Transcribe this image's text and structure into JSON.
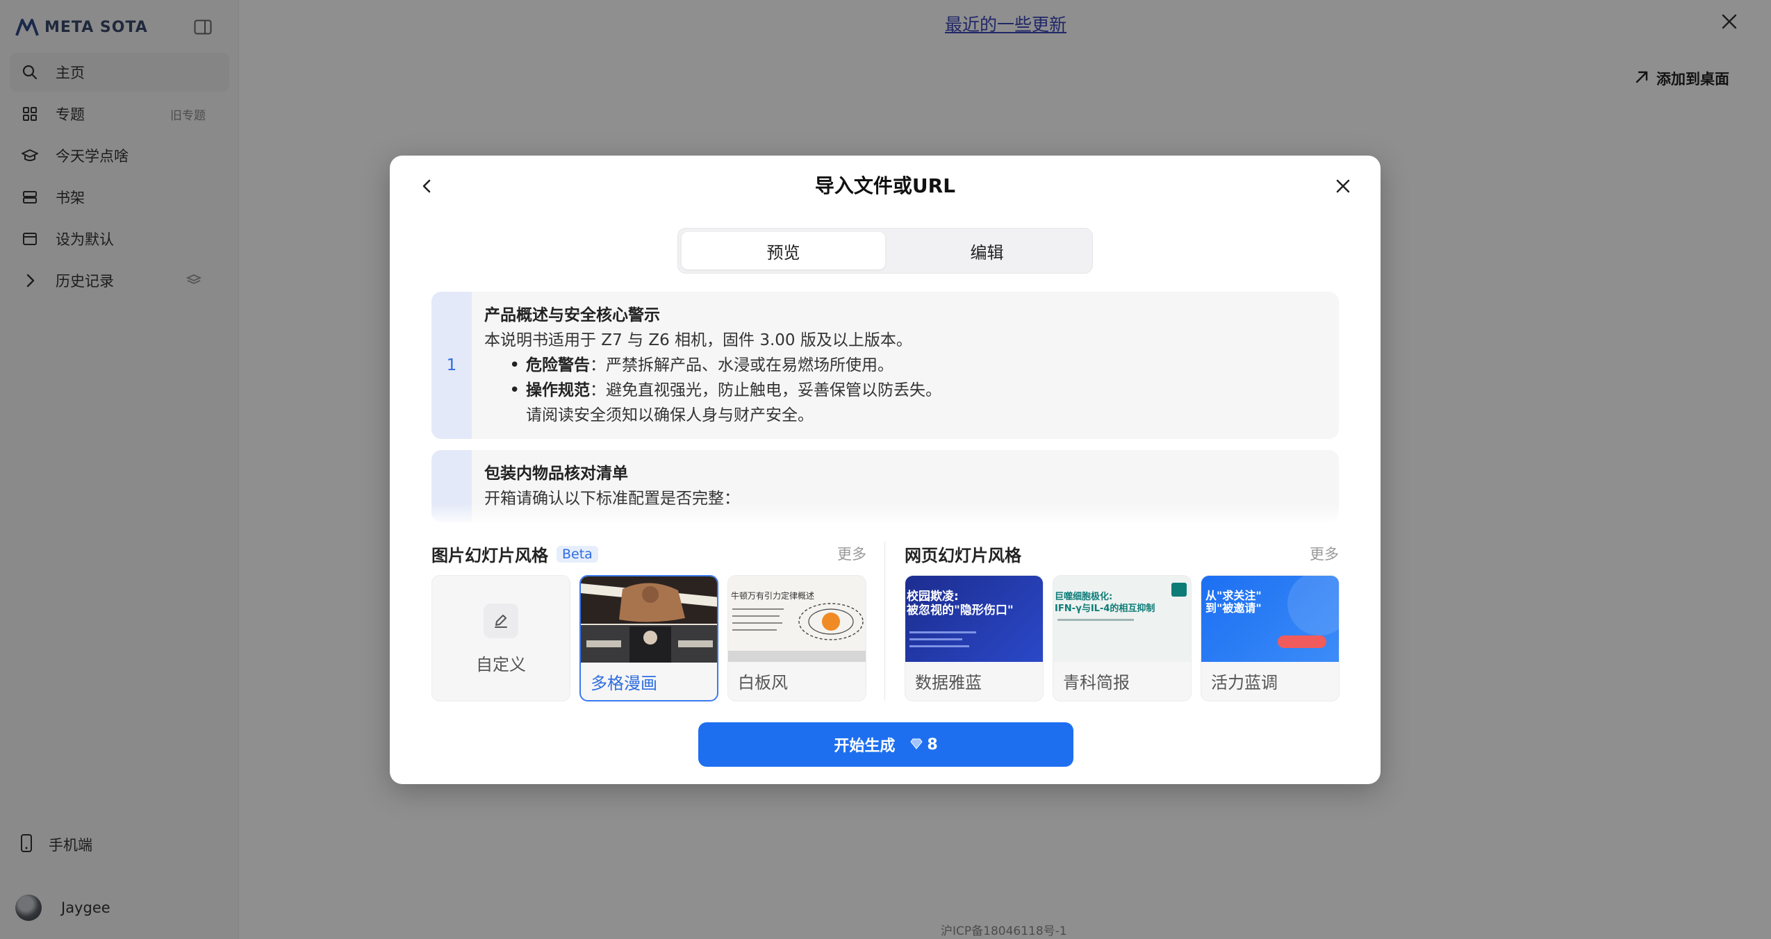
{
  "brand": {
    "name": "META SOTA"
  },
  "sidebar": {
    "items": [
      {
        "label": "主页",
        "icon": "search-icon"
      },
      {
        "label": "专题",
        "icon": "grid-icon",
        "badge": "旧专题"
      },
      {
        "label": "今天学点啥",
        "icon": "graduation-cap-icon"
      },
      {
        "label": "书架",
        "icon": "shelf-icon"
      },
      {
        "label": "设为默认",
        "icon": "window-icon"
      },
      {
        "label": "历史记录",
        "icon": "chevron-right-icon"
      }
    ],
    "mobile": "手机端",
    "user": "Jaygee"
  },
  "page": {
    "banner": "最近的一些更新",
    "add_desktop": "添加到桌面",
    "icp": "沪ICP备18046118号-1"
  },
  "modal": {
    "title": "导入文件或URL",
    "tabs": [
      {
        "label": "预览",
        "active": true
      },
      {
        "label": "编辑",
        "active": false
      }
    ],
    "cards": [
      {
        "num": "1",
        "title": "产品概述与安全核心警示",
        "intro": "本说明书适用于 Z7 与 Z6 相机，固件 3.00 版及以上版本。",
        "bullets": [
          {
            "bold": "危险警告",
            "text": "：严禁拆解产品、水浸或在易燃场所使用。"
          },
          {
            "bold": "操作规范",
            "text": "：避免直视强光，防止触电，妥善保管以防丢失。"
          }
        ],
        "note": "请阅读安全须知以确保人身与财产安全。"
      },
      {
        "num": "",
        "title": "包装内物品核对清单",
        "intro": "开箱请确认以下标准配置是否完整："
      }
    ],
    "image_styles": {
      "title": "图片幻灯片风格",
      "beta": "Beta",
      "more": "更多",
      "items": [
        {
          "label": "自定义",
          "icon": "edit-icon"
        },
        {
          "label": "多格漫画",
          "selected": true
        },
        {
          "label": "白板风",
          "thumb_text": "牛顿万有引力定律概述"
        }
      ]
    },
    "web_styles": {
      "title": "网页幻灯片风格",
      "more": "更多",
      "items": [
        {
          "label": "数据雅蓝",
          "thumb_text": "校园欺凌:\n被忽视的\"隐形伤口\""
        },
        {
          "label": "青科简报",
          "thumb_text": "巨噬细胞极化:\nIFN-γ与IL-4的相互抑制"
        },
        {
          "label": "活力蓝调",
          "thumb_text": "从\"求关注\"\n到\"被邀请\""
        }
      ]
    },
    "generate": {
      "label": "开始生成",
      "cost": "8"
    }
  },
  "colors": {
    "accent": "#1e6ff0",
    "selected_border": "#3a7af0",
    "overlay": "rgba(0,0,0,0.44)"
  }
}
